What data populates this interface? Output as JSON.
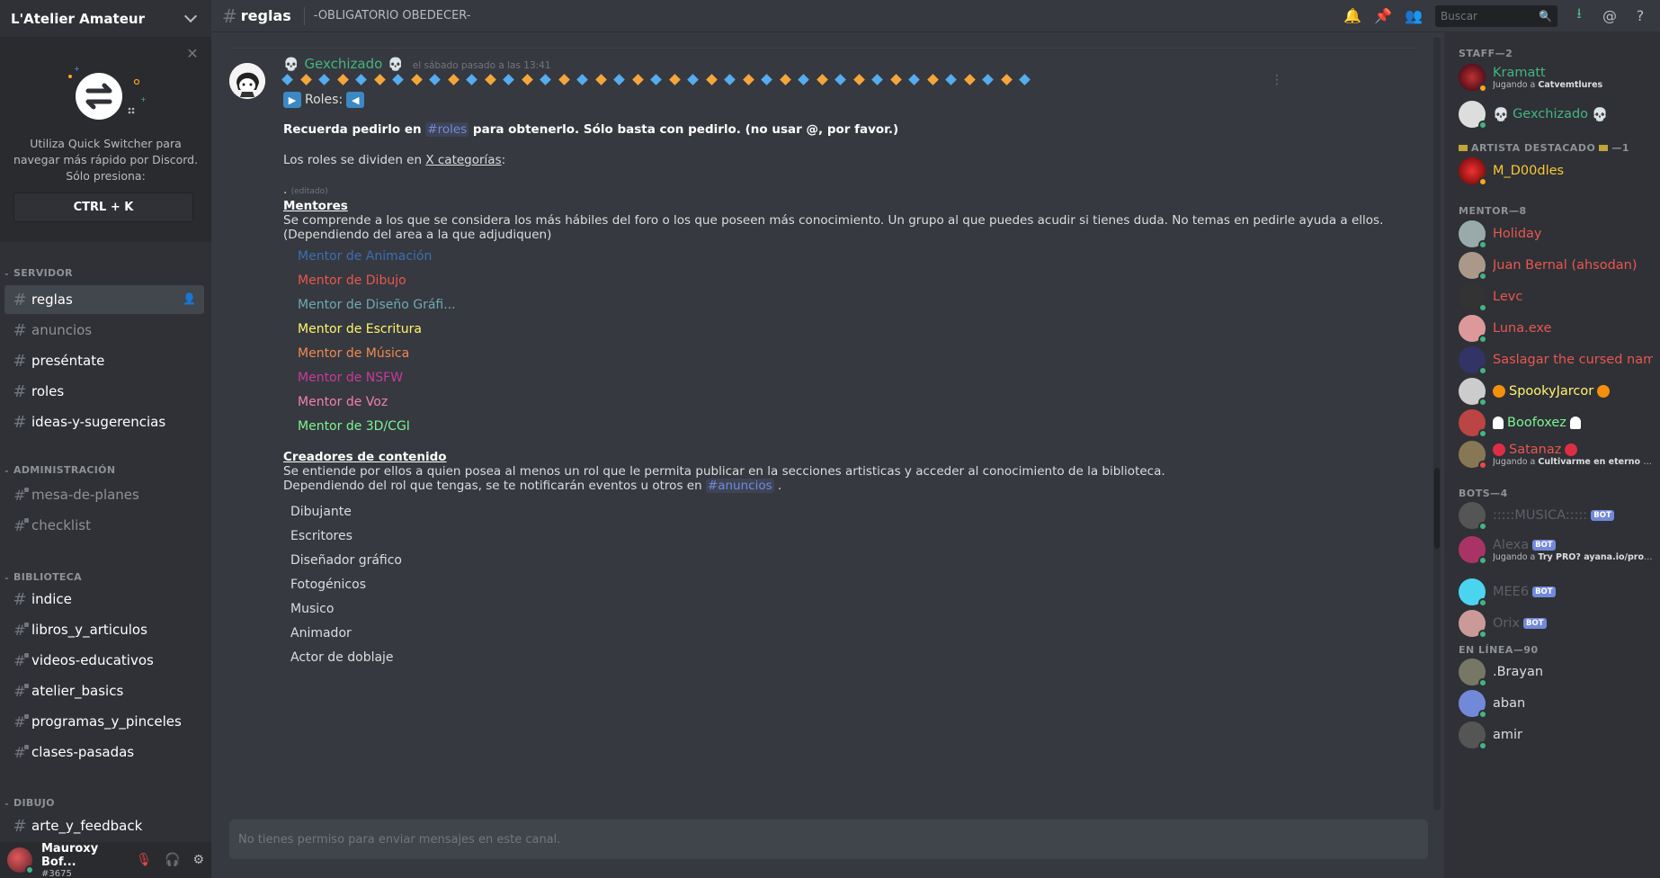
{
  "guild": {
    "name": "L'Atelier Amateur"
  },
  "quick_switcher": {
    "text_line1": "Utiliza Quick Switcher para",
    "text_line2": "navegar más rápido por Discord.",
    "text_line3": "Sólo presiona:",
    "shortcut": "CTRL + K"
  },
  "categories": {
    "servidor": "SERVIDOR",
    "administracion": "ADMINISTRACIÓN",
    "biblioteca": "BIBLIOTECA",
    "dibujo": "DIBUJO"
  },
  "channels": {
    "servidor": [
      "reglas",
      "anuncios",
      "preséntate",
      "roles",
      "ideas-y-sugerencias"
    ],
    "administracion": [
      "mesa-de-planes",
      "checklist"
    ],
    "biblioteca": [
      "indice",
      "libros_y_articulos",
      "videos-educativos",
      "atelier_basics",
      "programas_y_pinceles",
      "clases-pasadas"
    ],
    "dibujo": [
      "arte_y_feedback"
    ]
  },
  "user_panel": {
    "name": "Mauroxy Bof...",
    "tag": "#3675"
  },
  "topbar": {
    "channel": "reglas",
    "topic": "-OBLIGATORIO OBEDECER-",
    "search_placeholder": "Buscar"
  },
  "message": {
    "author": "Gexchizado",
    "timestamp": "el sábado pasado a las 13:41",
    "roles_label": "Roles:",
    "recuerda_pre": "Recuerda pedirlo en ",
    "recuerda_mention": "#roles",
    "recuerda_post": " para obtenerlo. Sólo basta con pedirlo. (no usar @, por favor.)",
    "categorias_pre": "Los roles se dividen en ",
    "categorias_link": "X categorías",
    "categorias_post": ":",
    "dot": ".",
    "edited": "(editado)",
    "mentores_title": "Mentores",
    "mentores_desc1": "Se comprende a los que se considera los más hábiles del foro o los que poseen más conocimiento. Un grupo al que puedes acudir si tienes duda. No temas en pedirle ayuda a ellos.",
    "mentores_desc2": "(Dependiendo del area a la que adjudiquen)",
    "mentor_roles": [
      {
        "name": "Mentor de Animación",
        "color": "#3b6fb6"
      },
      {
        "name": "Mentor de Dibujo",
        "color": "#e9574f"
      },
      {
        "name": "Mentor de Diseño Gráfi...",
        "color": "#6ea9b5"
      },
      {
        "name": "Mentor de Escritura",
        "color": "#fff56e"
      },
      {
        "name": "Mentor de Música",
        "color": "#f1894f"
      },
      {
        "name": "Mentor de NSFW",
        "color": "#c83a9c"
      },
      {
        "name": "Mentor de Voz",
        "color": "#f47fb4"
      },
      {
        "name": "Mentor de 3D/CGI",
        "color": "#7cf492"
      }
    ],
    "creadores_title": "Creadores de contenido",
    "creadores_desc1": "Se entiende por ellos a quien posea al menos un rol que le permita publicar en la secciones artisticas y acceder al conocimiento de la biblioteca.",
    "creadores_desc2_pre": "Dependiendo del rol que tengas, se te notificarán eventos u otros en ",
    "creadores_desc2_mention": "#anuncios",
    "creadores_desc2_post": " .",
    "creator_roles": [
      "Dibujante",
      "Escritores",
      "Diseñador gráfico",
      "Fotogénicos",
      "Musico",
      "Animador",
      "Actor de doblaje"
    ]
  },
  "composer": {
    "placeholder": "No tienes permiso para enviar mensajes en este canal."
  },
  "members": {
    "staff_header": "STAFF—2",
    "staff": [
      {
        "name": "Kramatt",
        "color": "#43b581",
        "activity_pre": "Jugando a ",
        "activity": "Catvemtlures",
        "status": "idle"
      },
      {
        "name": "Gexchizado",
        "color": "#43b581",
        "status": "online"
      }
    ],
    "artista_header": "ARTISTA DESTACADO",
    "artista_count": "—1",
    "artista": [
      {
        "name": "M_D00dles",
        "color": "#fac832",
        "status": "idle"
      }
    ],
    "mentor_header": "MENTOR—8",
    "mentors": [
      {
        "name": "Holiday",
        "color": "#e9574f",
        "status": "online"
      },
      {
        "name": "Juan Bernal (ahsodan)",
        "color": "#e9574f",
        "status": "online"
      },
      {
        "name": "Levc",
        "color": "#e9574f",
        "status": "online"
      },
      {
        "name": "Luna.exe",
        "color": "#e9574f",
        "status": "online"
      },
      {
        "name": "Saslagar the cursed nam...",
        "color": "#e9574f",
        "status": "online"
      },
      {
        "name": "SpookyJarcor",
        "color": "#fff56e",
        "status": "online"
      },
      {
        "name": "Boofoxez",
        "color": "#7cf492",
        "status": "online"
      },
      {
        "name": "Satanaz",
        "color": "#e9574f",
        "activity_pre": "Jugando a ",
        "activity": "Cultivarme en eterno co...",
        "status": "dnd"
      }
    ],
    "bots_header": "BOTS—4",
    "bots": [
      {
        "name": ":::::MÚSICA:::::",
        "color": "#5d6066",
        "status": "online"
      },
      {
        "name": "Alexa",
        "color": "#5d6066",
        "activity_pre": "Jugando a ",
        "activity": "Try PRO? ayana.io/pro |...",
        "status": "online"
      },
      {
        "name": "MEE6",
        "color": "#5d6066",
        "status": "online"
      },
      {
        "name": "Orix",
        "color": "#5d6066",
        "status": "online"
      }
    ],
    "bot_tag": "BOT",
    "online_header": "EN LÍNEA—90",
    "online": [
      {
        "name": ".Brayan",
        "color": "#dcddde",
        "status": "online"
      },
      {
        "name": "aban",
        "color": "#dcddde",
        "status": "online"
      },
      {
        "name": "amir",
        "color": "#dcddde",
        "status": "online"
      }
    ]
  }
}
